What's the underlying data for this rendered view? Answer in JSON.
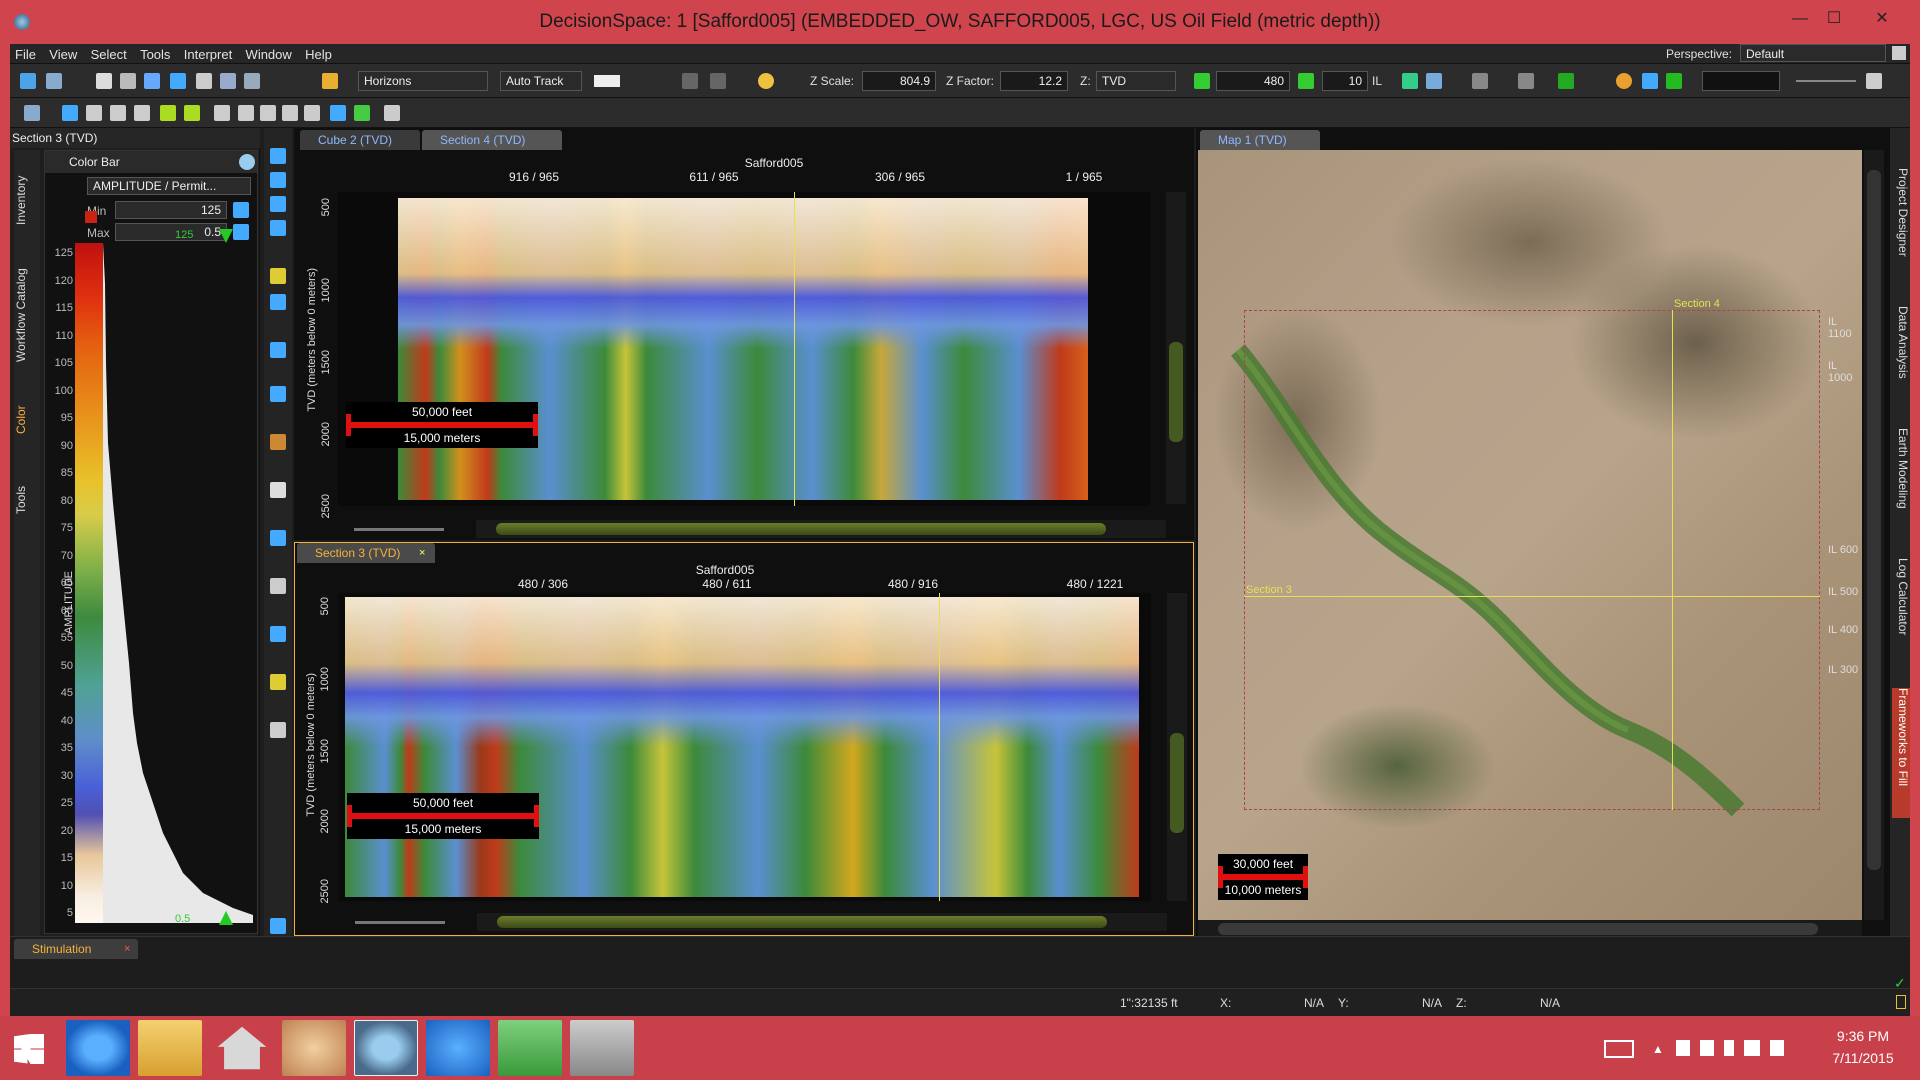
{
  "window": {
    "title": "DecisionSpace: 1 [Safford005] (EMBEDDED_OW, SAFFORD005, LGC, US Oil Field (metric depth))",
    "minimize": "—",
    "maximize": "☐",
    "close": "✕"
  },
  "menu": [
    "File",
    "View",
    "Select",
    "Tools",
    "Interpret",
    "Window",
    "Help"
  ],
  "perspective": {
    "label": "Perspective:",
    "value": "Default"
  },
  "toolbar": {
    "horizons": "Horizons",
    "auto_track": "Auto Track",
    "z_scale_label": "Z Scale:",
    "z_scale_value": "804.9",
    "z_factor_label": "Z Factor:",
    "z_factor_value": "12.2",
    "z_label": "Z:",
    "z_value": "TVD",
    "frame_value": "480",
    "step_value": "10",
    "il_label": "IL"
  },
  "left_panel": {
    "title": "Section 3 (TVD)",
    "vtabs": [
      "Inventory",
      "Workflow Catalog",
      "Color",
      "Tools"
    ],
    "colorbar": {
      "title": "Color Bar",
      "attribute": "AMPLITUDE / Permit...",
      "min_label": "Min",
      "min_value": "125",
      "max_label": "Max",
      "max_value": "0.5",
      "top_value": "125",
      "bottom_value": "0.5",
      "axis_title": "AMPLITUDE",
      "ticks": [
        "125",
        "120",
        "115",
        "110",
        "105",
        "100",
        "95",
        "90",
        "85",
        "80",
        "75",
        "70",
        "65",
        "60",
        "55",
        "50",
        "45",
        "40",
        "35",
        "30",
        "25",
        "20",
        "15",
        "10",
        "5"
      ]
    }
  },
  "top_view": {
    "tabs": [
      "Cube 2 (TVD)",
      "Section 4 (TVD)"
    ],
    "well": "Safford005",
    "x_ticks": [
      "916 / 965",
      "611 / 965",
      "306 / 965",
      "1 / 965"
    ],
    "y_label": "TVD (meters below 0 meters)",
    "y_ticks": [
      "500",
      "1000",
      "1500",
      "2000",
      "2500"
    ],
    "scale_feet": "50,000 feet",
    "scale_meters": "15,000 meters"
  },
  "bottom_view": {
    "tab": "Section 3 (TVD)",
    "well": "Safford005",
    "x_ticks": [
      "480 / 306",
      "480 / 611",
      "480 / 916",
      "480 / 1221"
    ],
    "y_label": "TVD (meters below 0 meters)",
    "y_ticks": [
      "500",
      "1000",
      "1500",
      "2000",
      "2500"
    ],
    "scale_feet": "50,000 feet",
    "scale_meters": "15,000 meters"
  },
  "map_view": {
    "tab": "Map 1 (TVD)",
    "section4_label": "Section 4",
    "section3_label": "Section 3",
    "il_labels": [
      "IL 1100",
      "IL 1000",
      "IL 600",
      "IL 500",
      "IL 400",
      "IL 300"
    ],
    "scale_feet": "30,000 feet",
    "scale_meters": "10,000 meters"
  },
  "right_vtabs": [
    "Project Designer",
    "Data Analysis",
    "Earth Modeling",
    "Log Calculator",
    "Frameworks to Fill"
  ],
  "bottom_tab": "Stimulation",
  "status": {
    "scale": "1\":32135 ft",
    "x_label": "X:",
    "x_value": "N/A",
    "y_label": "Y:",
    "y_value": "N/A",
    "z_label": "Z:",
    "z_value": "N/A"
  },
  "taskbar": {
    "time": "9:36 PM",
    "date": "7/11/2015"
  },
  "colors": {
    "title_bg": "#d0454d",
    "accent_orange": "#f5b23a",
    "tab_blue": "#8fb8ff",
    "scale_red": "#e01010"
  }
}
